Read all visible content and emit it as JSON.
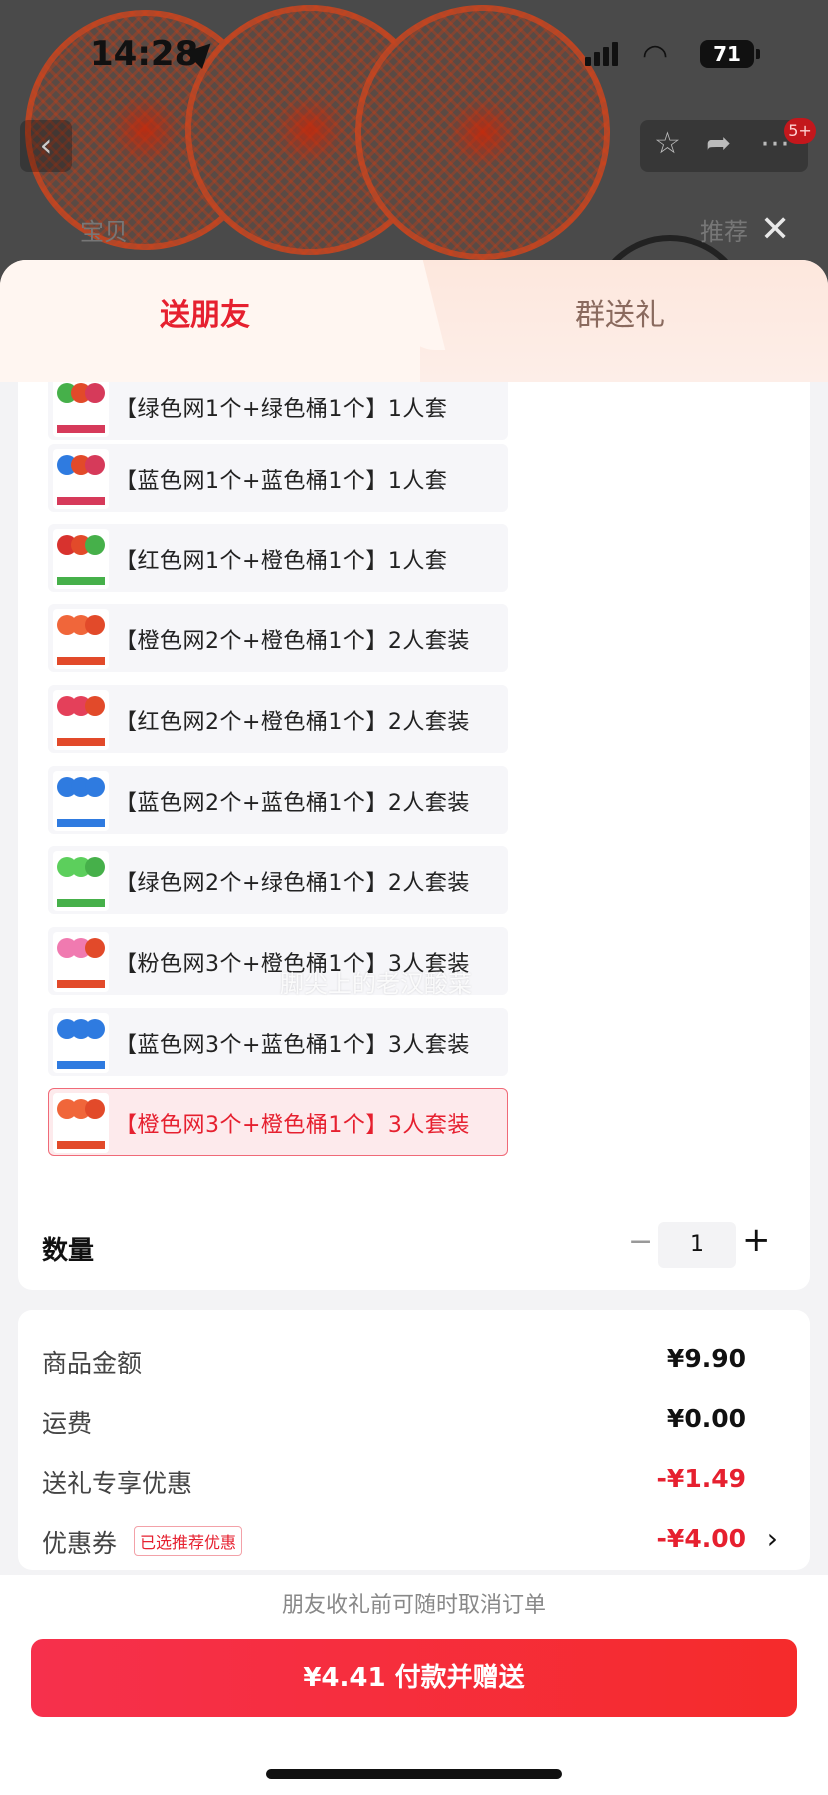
{
  "status_bar": {
    "time": "14:28",
    "battery": "71"
  },
  "nav": {
    "back": "‹",
    "cart_badge": "5+",
    "faded_left": "宝贝",
    "faded_right": "推荐"
  },
  "tabs": [
    {
      "label": "送朋友",
      "active": true
    },
    {
      "label": "群送礼",
      "active": false
    }
  ],
  "options": [
    {
      "label": "【绿色网1个+绿色桶1个】1人套",
      "colors": [
        "#46b04a",
        "#e24a2a",
        "#d63a5a"
      ],
      "selected": false
    },
    {
      "label": "【蓝色网1个+蓝色桶1个】1人套",
      "colors": [
        "#2f7be0",
        "#e24a2a",
        "#d63a5a"
      ],
      "selected": false
    },
    {
      "label": "【红色网1个+橙色桶1个】1人套",
      "colors": [
        "#d8322e",
        "#e24a2a",
        "#46b04a"
      ],
      "selected": false
    },
    {
      "label": "【橙色网2个+橙色桶1个】2人套装",
      "colors": [
        "#f0663a",
        "#f0663a",
        "#e24a2a"
      ],
      "selected": false
    },
    {
      "label": "【红色网2个+橙色桶1个】2人套装",
      "colors": [
        "#e4405a",
        "#e4405a",
        "#e24a2a"
      ],
      "selected": false
    },
    {
      "label": "【蓝色网2个+蓝色桶1个】2人套装",
      "colors": [
        "#2f7be0",
        "#2f7be0",
        "#2f7be0"
      ],
      "selected": false
    },
    {
      "label": "【绿色网2个+绿色桶1个】2人套装",
      "colors": [
        "#5ccf5c",
        "#5ccf5c",
        "#46b04a"
      ],
      "selected": false
    },
    {
      "label": "【粉色网3个+橙色桶1个】3人套装",
      "colors": [
        "#f07ab0",
        "#f07ab0",
        "#e24a2a"
      ],
      "selected": false
    },
    {
      "label": "【蓝色网3个+蓝色桶1个】3人套装",
      "colors": [
        "#2f7be0",
        "#2f7be0",
        "#2f7be0"
      ],
      "selected": false
    },
    {
      "label": "【橙色网3个+橙色桶1个】3人套装",
      "colors": [
        "#f0663a",
        "#f0663a",
        "#e24a2a"
      ],
      "selected": true
    }
  ],
  "watermark": "脚尖上的老汉酸菜",
  "quantity": {
    "label": "数量",
    "minus": "−",
    "value": "1",
    "plus": "+"
  },
  "price": {
    "goods_label": "商品金额",
    "goods_value": "¥9.90",
    "shipping_label": "运费",
    "shipping_value": "¥0.00",
    "gift_discount_label": "送礼专享优惠",
    "gift_discount_value": "-¥1.49",
    "coupon_label": "优惠券",
    "coupon_badge": "已选推荐优惠",
    "coupon_value": "-¥4.00"
  },
  "footer": {
    "note": "朋友收礼前可随时取消订单",
    "pay_button": "¥4.41 付款并赠送"
  },
  "accent_color": "#e6202f"
}
